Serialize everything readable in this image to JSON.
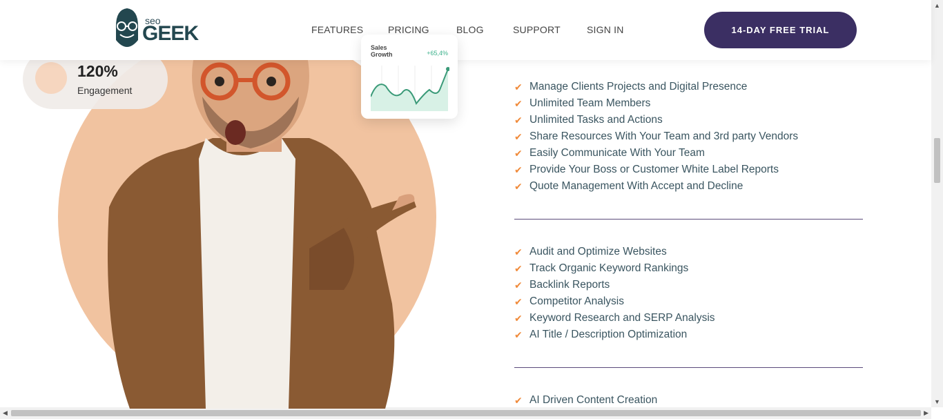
{
  "header": {
    "logo_small": "seo",
    "logo_big": "GEEK",
    "nav": [
      "FEATURES",
      "PRICING",
      "BLOG",
      "SUPPORT",
      "SIGN IN"
    ],
    "cta": "14-DAY FREE TRIAL"
  },
  "hero": {
    "engagement_value": "120%",
    "engagement_label": "Engagement",
    "sales_title": "Sales Growth",
    "sales_percent": "+65,4%"
  },
  "features": {
    "group1": [
      "Manage Clients Projects and Digital Presence",
      "Unlimited Team Members",
      "Unlimited Tasks and Actions",
      "Share Resources With Your Team and 3rd party Vendors",
      "Easily Communicate With Your Team",
      "Provide Your Boss or Customer White Label Reports",
      "Quote Management With Accept and Decline"
    ],
    "group2": [
      "Audit and Optimize Websites",
      "Track Organic Keyword Rankings",
      "Backlink Reports",
      "Competitor Analysis",
      "Keyword Research and SERP Analysis",
      "AI Title / Description Optimization"
    ],
    "group3": [
      "AI Driven Content Creation"
    ]
  },
  "colors": {
    "accent_orange": "#f08a3a",
    "cta_purple": "#3b2f63",
    "circle_peach": "#f1c3a0"
  }
}
